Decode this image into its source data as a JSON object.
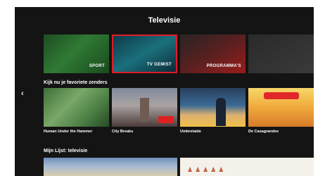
{
  "header": {
    "title": "Televisie"
  },
  "categories": [
    {
      "label": "SPORT"
    },
    {
      "label": "TV GEMIST",
      "selected": true
    },
    {
      "label": "PROGRAMMA'S"
    },
    {
      "label": ""
    }
  ],
  "favorites": {
    "title": "Kijk nu je favoriete zenders",
    "nav_icon": "chevron-left-icon",
    "items": [
      {
        "title": "Human Under the Hammer",
        "subtitle": ""
      },
      {
        "title": "City Breaks",
        "subtitle": ""
      },
      {
        "title": "Umbrelaide",
        "subtitle": ""
      },
      {
        "title": "De Casagrandes",
        "subtitle": ""
      }
    ]
  },
  "mylist": {
    "title": "Mijn Lijst: televisie"
  },
  "colors": {
    "background": "#141414",
    "accent": "#e01b2a"
  }
}
